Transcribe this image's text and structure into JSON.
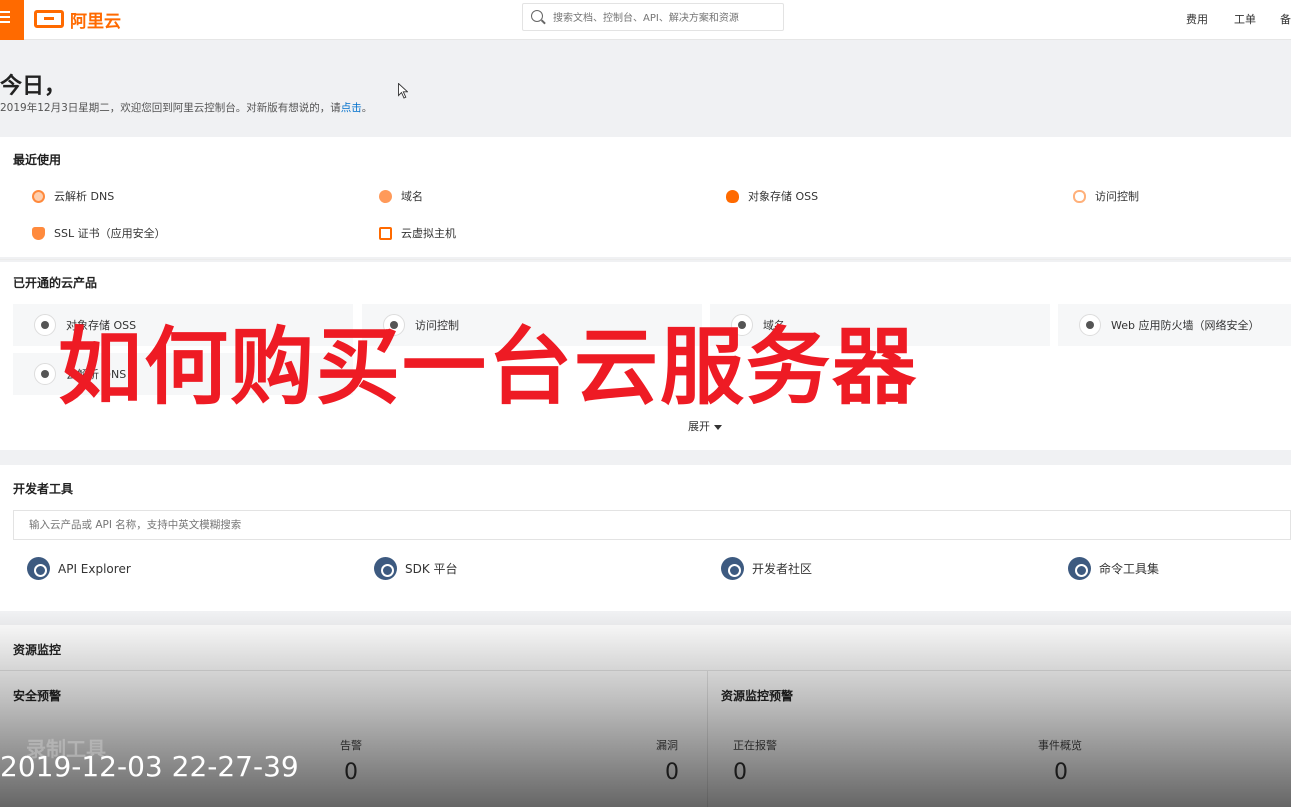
{
  "header": {
    "logo_text": "阿里云",
    "search_placeholder": "搜索文档、控制台、API、解决方案和资源",
    "links": {
      "fee": "费用",
      "order": "工单",
      "more": "备"
    }
  },
  "greeting": {
    "title": "今日，",
    "subtitle": "2019年12月3日星期二，欢迎您回到阿里云控制台。对新版有想说的，请",
    "link": "点击",
    "tail": "。"
  },
  "recent": {
    "title": "最近使用",
    "items": [
      {
        "label": "云解析 DNS",
        "icon": "dns-icon"
      },
      {
        "label": "域名",
        "icon": "globe-icon"
      },
      {
        "label": "对象存储 OSS",
        "icon": "cloud-storage-icon"
      },
      {
        "label": "访问控制",
        "icon": "cloud-access-icon"
      },
      {
        "label": "SSL 证书（应用安全）",
        "icon": "shield-icon"
      },
      {
        "label": "云虚拟主机",
        "icon": "virtual-host-icon"
      }
    ]
  },
  "opened": {
    "title": "已开通的云产品",
    "items": [
      {
        "label": "对象存储 OSS"
      },
      {
        "label": "访问控制"
      },
      {
        "label": "域名"
      },
      {
        "label": "Web 应用防火墙（网络安全）"
      },
      {
        "label": "云解析 DNS"
      }
    ],
    "expand": "展开"
  },
  "overlay_title": "如何购买一台云服务器",
  "dev_tools": {
    "title": "开发者工具",
    "input_placeholder": "输入云产品或 API 名称，支持中英文模糊搜索",
    "items": [
      {
        "label": "API Explorer"
      },
      {
        "label": "SDK 平台"
      },
      {
        "label": "开发者社区"
      },
      {
        "label": "命令工具集"
      }
    ]
  },
  "monitor": {
    "title": "资源监控",
    "security": {
      "title": "安全预警",
      "stats": [
        {
          "label": "告警",
          "value": "0"
        },
        {
          "label": "漏洞",
          "value": "0"
        }
      ]
    },
    "resource": {
      "title": "资源监控预警",
      "stats": [
        {
          "label": "正在报警",
          "value": "0"
        },
        {
          "label": "事件概览",
          "value": "0"
        }
      ]
    }
  },
  "video": {
    "timestamp": "2019-12-03 22-27-39",
    "watermark": "录制工具"
  },
  "colors": {
    "brand": "#ff6a00",
    "overlay": "#ee1b24",
    "link": "#0070cc"
  }
}
